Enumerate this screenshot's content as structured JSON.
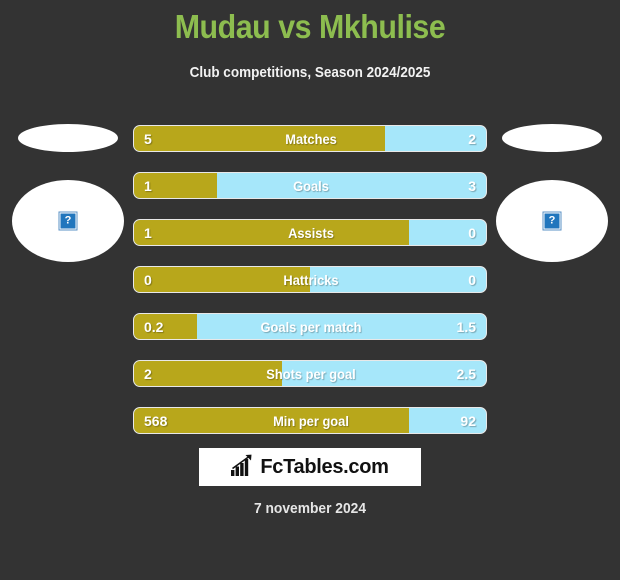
{
  "header": {
    "title": "Mudau vs Mkhulise",
    "subtitle": "Club competitions, Season 2024/2025",
    "title_color": "#8dbd4f"
  },
  "colors": {
    "background": "#333333",
    "home_bar": "#b8a71b",
    "away_bar": "#a6e7fa",
    "text": "#ffffff"
  },
  "players": {
    "home": {
      "photo_icon": "broken-image-icon",
      "photo_placeholder": "?"
    },
    "away": {
      "photo_icon": "broken-image-icon",
      "photo_placeholder": "?"
    }
  },
  "stats": [
    {
      "label": "Matches",
      "home": "5",
      "away": "2",
      "home_pct": 71.4
    },
    {
      "label": "Goals",
      "home": "1",
      "away": "3",
      "home_pct": 23.6
    },
    {
      "label": "Assists",
      "home": "1",
      "away": "0",
      "home_pct": 78.0
    },
    {
      "label": "Hattricks",
      "home": "0",
      "away": "0",
      "home_pct": 50.0
    },
    {
      "label": "Goals per match",
      "home": "0.2",
      "away": "1.5",
      "home_pct": 18.0
    },
    {
      "label": "Shots per goal",
      "home": "2",
      "away": "2.5",
      "home_pct": 42.0
    },
    {
      "label": "Min per goal",
      "home": "568",
      "away": "92",
      "home_pct": 78.0
    }
  ],
  "logo": {
    "text": "FcTables.com",
    "icon": "bar-chart-growth-icon"
  },
  "footer": {
    "date": "7 november 2024"
  },
  "chart_data": {
    "type": "bar",
    "title": "Mudau vs Mkhulise",
    "subtitle": "Club competitions, Season 2024/2025",
    "categories": [
      "Matches",
      "Goals",
      "Assists",
      "Hattricks",
      "Goals per match",
      "Shots per goal",
      "Min per goal"
    ],
    "series": [
      {
        "name": "Mudau",
        "values": [
          5,
          1,
          1,
          0,
          0.2,
          2,
          568
        ]
      },
      {
        "name": "Mkhulise",
        "values": [
          2,
          3,
          0,
          0,
          1.5,
          2.5,
          92
        ]
      }
    ],
    "orientation": "horizontal",
    "stacked": true,
    "legend": "none",
    "grid": false
  }
}
